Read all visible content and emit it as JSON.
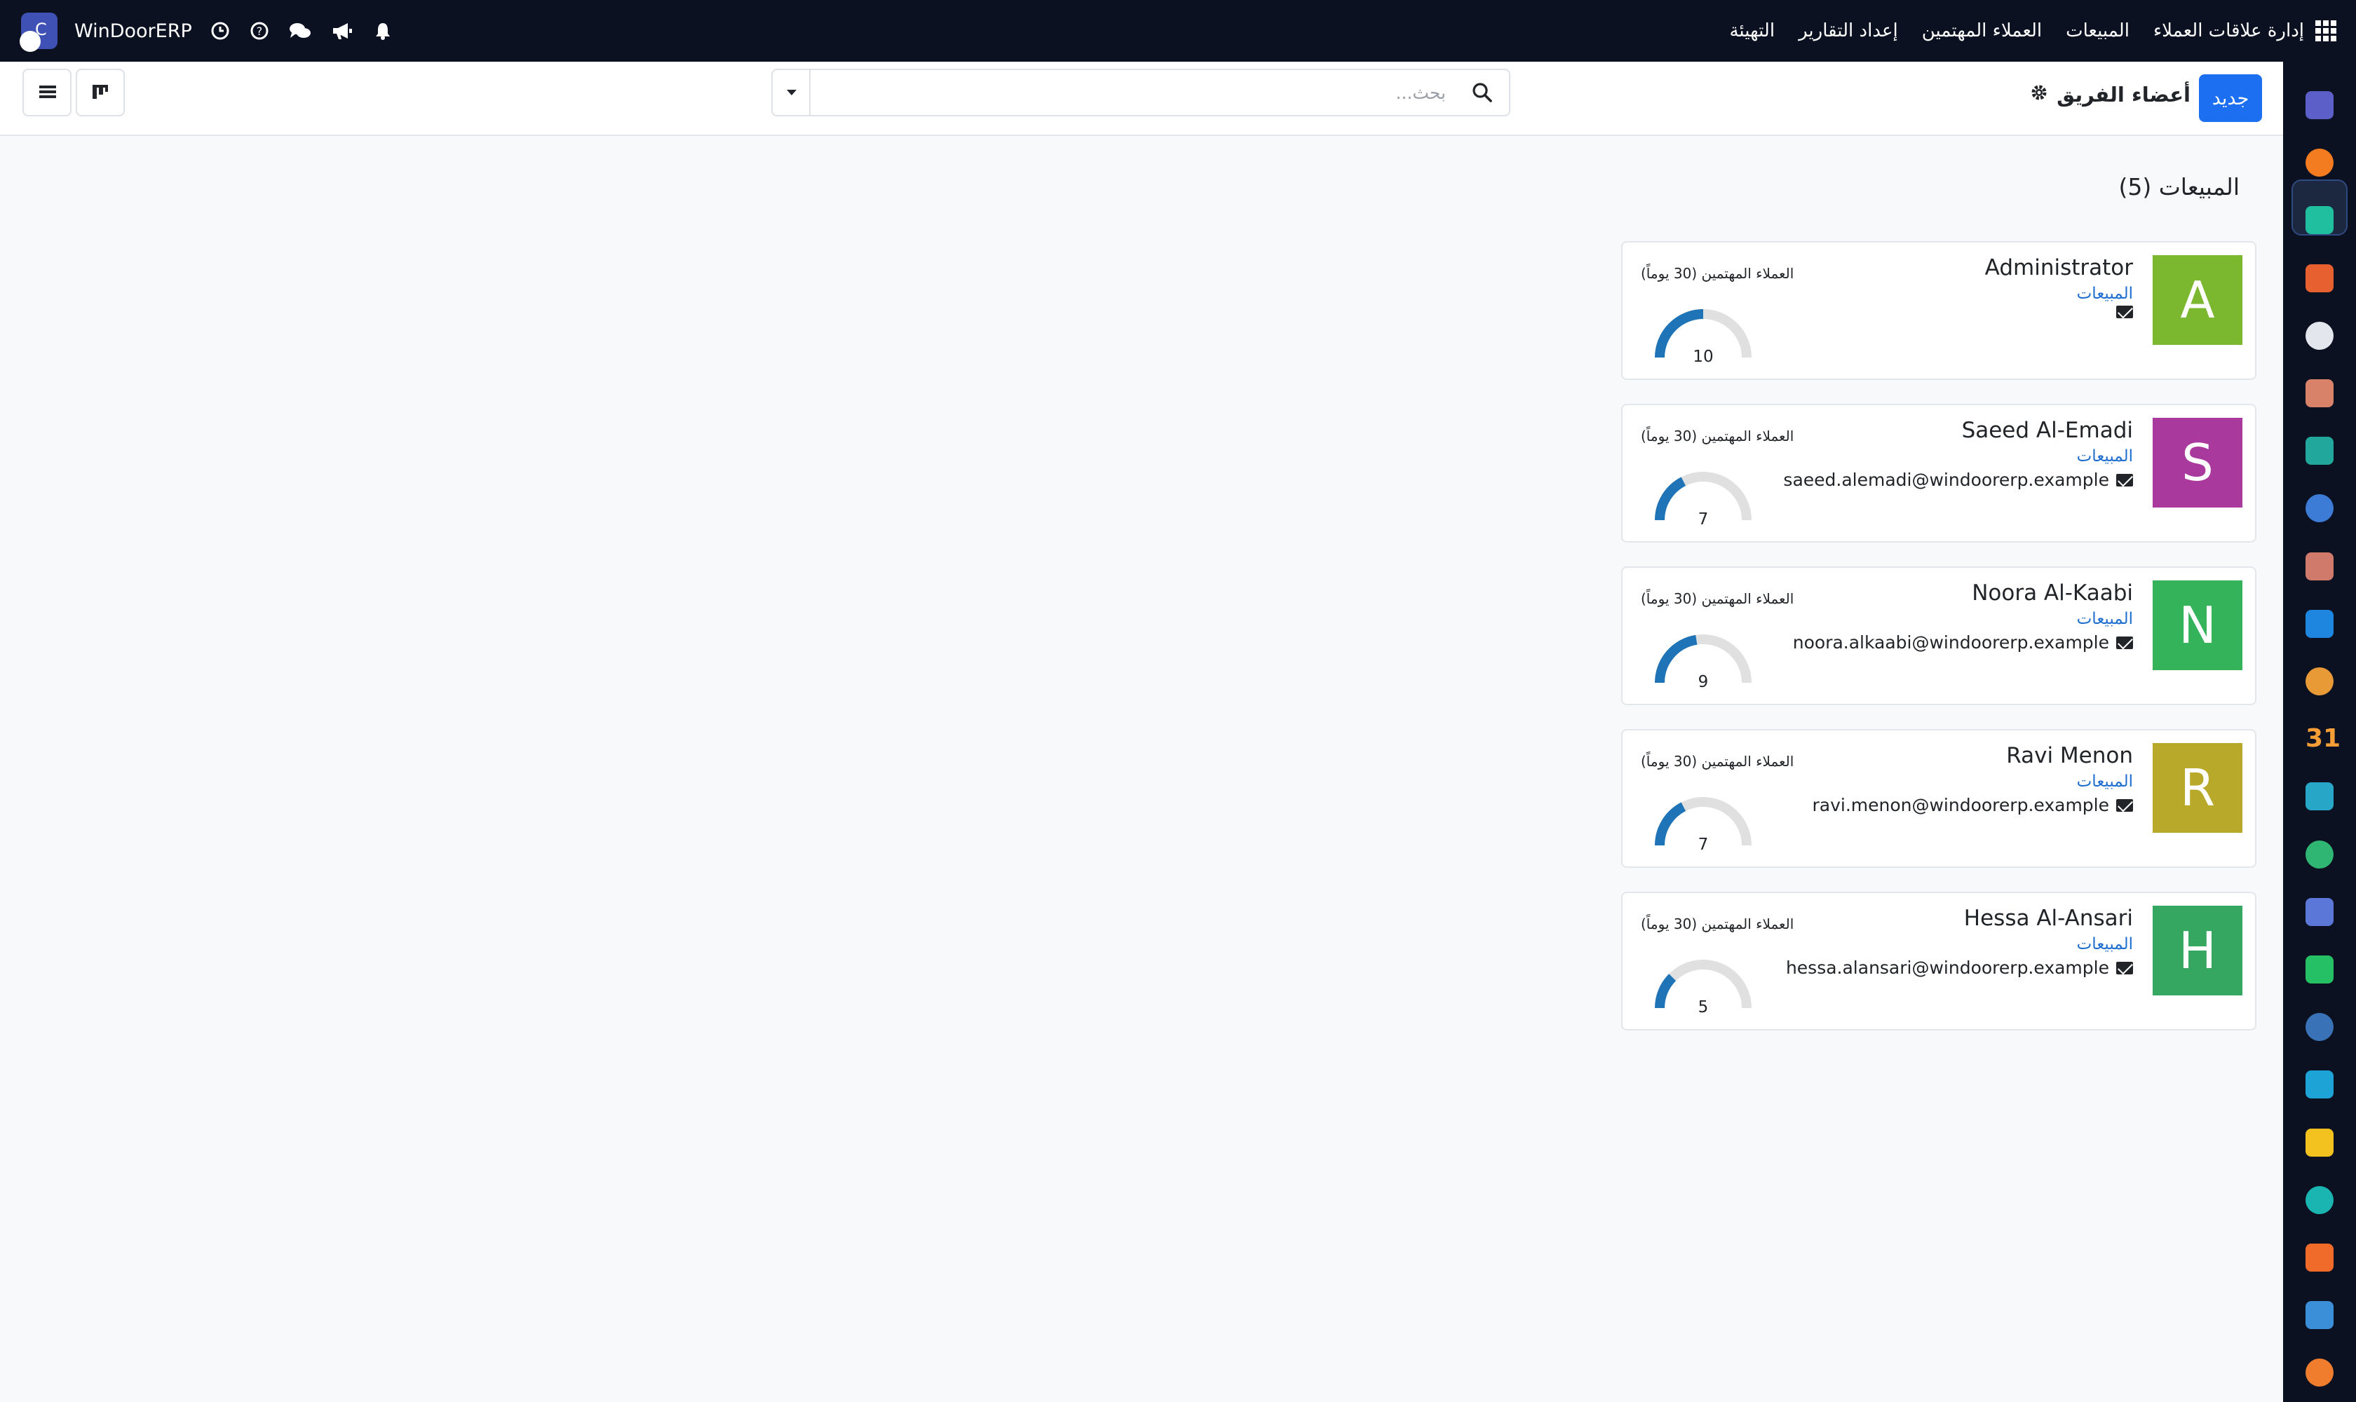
{
  "topbar": {
    "brand": "WinDoorERP",
    "menu": [
      "إدارة علاقات العملاء",
      "المبيعات",
      "العملاء المهتمين",
      "إعداد التقارير",
      "التهيئة"
    ],
    "icons": [
      "clock-icon",
      "help-icon",
      "chat-icon",
      "megaphone-icon",
      "bell-icon"
    ]
  },
  "control_panel": {
    "new_button": "جديد",
    "title": "أعضاء الفريق",
    "search_placeholder": "بحث..."
  },
  "group": {
    "title": "المبيعات (5)"
  },
  "members": [
    {
      "initial": "A",
      "name": "Administrator",
      "team": "المبيعات",
      "email": "",
      "color": "#7cb82f",
      "gauge_label": "العملاء المهتمين (30 يوماً)",
      "value": 10,
      "max": 20
    },
    {
      "initial": "S",
      "name": "Saeed Al-Emadi",
      "team": "المبيعات",
      "email": "saeed.alemadi@windoorerp.example",
      "color": "#a9399c",
      "gauge_label": "العملاء المهتمين (30 يوماً)",
      "value": 7,
      "max": 20
    },
    {
      "initial": "N",
      "name": "Noora Al-Kaabi",
      "team": "المبيعات",
      "email": "noora.alkaabi@windoorerp.example",
      "color": "#34b35a",
      "gauge_label": "العملاء المهتمين (30 يوماً)",
      "value": 9,
      "max": 20
    },
    {
      "initial": "R",
      "name": "Ravi Menon",
      "team": "المبيعات",
      "email": "ravi.menon@windoorerp.example",
      "color": "#b8a92a",
      "gauge_label": "العملاء المهتمين (30 يوماً)",
      "value": 7,
      "max": 20
    },
    {
      "initial": "H",
      "name": "Hessa Al-Ansari",
      "team": "المبيعات",
      "email": "hessa.alansari@windoorerp.example",
      "color": "#36a760",
      "gauge_label": "العملاء المهتمين (30 يوماً)",
      "value": 5,
      "max": 20
    }
  ],
  "colors": {
    "navbar": "#0b1120",
    "primary_button": "#1d6ff2",
    "gauge_fill": "#1f73b7",
    "gauge_track": "#e0e0e0",
    "link": "#1f6fd0"
  },
  "app_sidebar": {
    "icons": [
      "mail-app-icon",
      "discuss-app-icon",
      "crm-app-icon",
      "reporting-app-icon",
      "inventory-app-icon",
      "photos-app-icon",
      "project-app-icon",
      "knowledge-app-icon",
      "purchase-app-icon",
      "invoicing-app-icon",
      "employees-app-icon",
      "calendar-app-icon",
      "sign-app-icon",
      "contacts-app-icon",
      "dashboard-app-icon",
      "whatsapp-app-icon",
      "timer-app-icon",
      "website-app-icon",
      "email-marketing-app-icon",
      "planning-app-icon",
      "odoo-app-icon",
      "pie-app-icon",
      "settings-app-icon"
    ],
    "colors": [
      "#5b5fc7",
      "#f47c20",
      "#1fbf9f",
      "#e7602f",
      "#e3e6ec",
      "#d9826a",
      "#21a79b",
      "#3c7cd6",
      "#d07a6c",
      "#1f86e0",
      "#e79a36",
      "#f59d36",
      "#28a6c8",
      "#2fb673",
      "#5b78d8",
      "#25c065",
      "#3a72b8",
      "#1ea3d6",
      "#f4c21f",
      "#1ab5b0",
      "#f06a2a",
      "#3b8fd9",
      "#f07d2e"
    ],
    "calendar_label": "31"
  }
}
